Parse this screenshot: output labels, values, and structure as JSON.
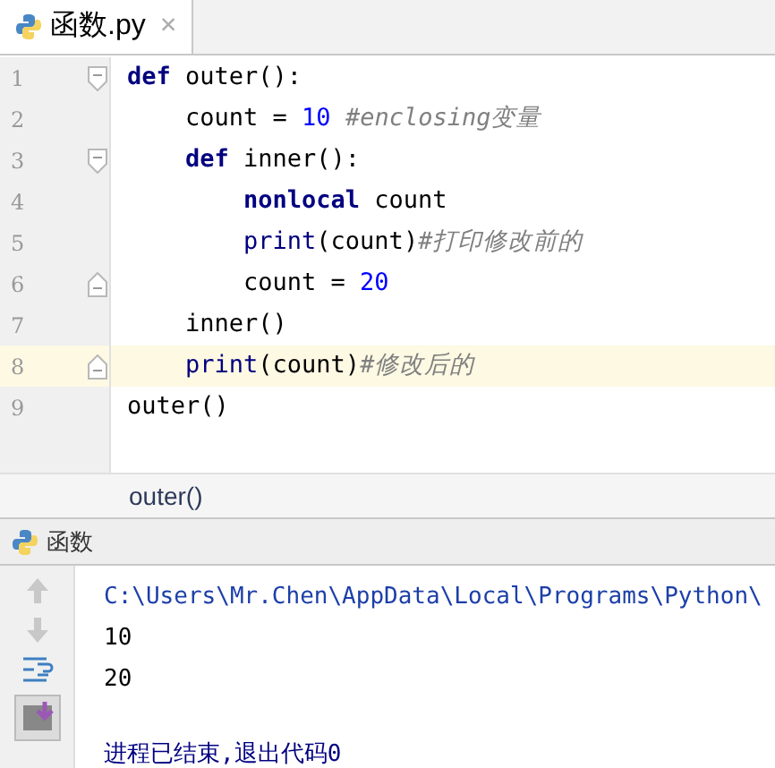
{
  "tab": {
    "label": "函数.py",
    "close": "×",
    "selected": true
  },
  "code_lines": [
    {
      "number": "1",
      "fold_start": true,
      "fold_end": false,
      "current": false,
      "tokens": [
        {
          "kind": "kw",
          "text": "def"
        },
        {
          "kind": "plain",
          "text": " outer():"
        }
      ]
    },
    {
      "number": "2",
      "fold_start": false,
      "fold_end": false,
      "current": false,
      "tokens": [
        {
          "kind": "plain",
          "text": "    count = "
        },
        {
          "kind": "num",
          "text": "10"
        },
        {
          "kind": "comment",
          "text": " #enclosing变量"
        }
      ]
    },
    {
      "number": "3",
      "fold_start": true,
      "fold_end": false,
      "current": false,
      "tokens": [
        {
          "kind": "kw",
          "text": "    def"
        },
        {
          "kind": "plain",
          "text": " inner():"
        }
      ]
    },
    {
      "number": "4",
      "fold_start": false,
      "fold_end": false,
      "current": false,
      "tokens": [
        {
          "kind": "kw",
          "text": "        nonlocal"
        },
        {
          "kind": "plain",
          "text": " count"
        }
      ]
    },
    {
      "number": "5",
      "fold_start": false,
      "fold_end": false,
      "current": false,
      "tokens": [
        {
          "kind": "builtin",
          "text": "        print"
        },
        {
          "kind": "plain",
          "text": "(count)"
        },
        {
          "kind": "comment",
          "text": "#打印修改前的"
        }
      ]
    },
    {
      "number": "6",
      "fold_start": false,
      "fold_end": true,
      "current": false,
      "tokens": [
        {
          "kind": "plain",
          "text": "        count = "
        },
        {
          "kind": "num",
          "text": "20"
        }
      ]
    },
    {
      "number": "7",
      "fold_start": false,
      "fold_end": false,
      "current": false,
      "tokens": [
        {
          "kind": "plain",
          "text": "    inner()"
        }
      ]
    },
    {
      "number": "8",
      "fold_start": false,
      "fold_end": true,
      "current": true,
      "tokens": [
        {
          "kind": "builtin",
          "text": "    print"
        },
        {
          "kind": "plain",
          "text": "(count)"
        },
        {
          "kind": "comment",
          "text": "#修改后的"
        }
      ]
    },
    {
      "number": "9",
      "fold_start": false,
      "fold_end": false,
      "current": false,
      "tokens": [
        {
          "kind": "plain",
          "text": "outer()"
        }
      ]
    }
  ],
  "breadcrumb": "outer()",
  "run_panel": {
    "config": "函数"
  },
  "console_lines": [
    {
      "kind": "command",
      "text": "C:\\Users\\Mr.Chen\\AppData\\Local\\Programs\\Python\\"
    },
    {
      "kind": "output",
      "text": "10"
    },
    {
      "kind": "output",
      "text": "20"
    },
    {
      "kind": "status",
      "text": "进程已结束,退出代码0"
    }
  ]
}
